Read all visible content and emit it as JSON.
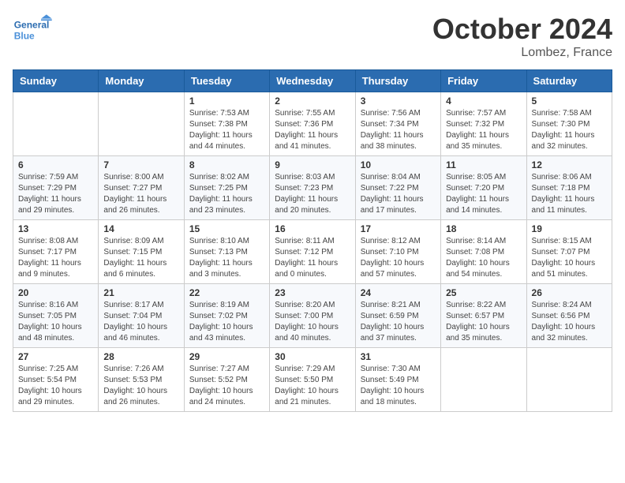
{
  "header": {
    "logo_general": "General",
    "logo_blue": "Blue",
    "month": "October 2024",
    "location": "Lombez, France"
  },
  "weekdays": [
    "Sunday",
    "Monday",
    "Tuesday",
    "Wednesday",
    "Thursday",
    "Friday",
    "Saturday"
  ],
  "weeks": [
    [
      {
        "day": "",
        "sunrise": "",
        "sunset": "",
        "daylight": ""
      },
      {
        "day": "",
        "sunrise": "",
        "sunset": "",
        "daylight": ""
      },
      {
        "day": "1",
        "sunrise": "Sunrise: 7:53 AM",
        "sunset": "Sunset: 7:38 PM",
        "daylight": "Daylight: 11 hours and 44 minutes."
      },
      {
        "day": "2",
        "sunrise": "Sunrise: 7:55 AM",
        "sunset": "Sunset: 7:36 PM",
        "daylight": "Daylight: 11 hours and 41 minutes."
      },
      {
        "day": "3",
        "sunrise": "Sunrise: 7:56 AM",
        "sunset": "Sunset: 7:34 PM",
        "daylight": "Daylight: 11 hours and 38 minutes."
      },
      {
        "day": "4",
        "sunrise": "Sunrise: 7:57 AM",
        "sunset": "Sunset: 7:32 PM",
        "daylight": "Daylight: 11 hours and 35 minutes."
      },
      {
        "day": "5",
        "sunrise": "Sunrise: 7:58 AM",
        "sunset": "Sunset: 7:30 PM",
        "daylight": "Daylight: 11 hours and 32 minutes."
      }
    ],
    [
      {
        "day": "6",
        "sunrise": "Sunrise: 7:59 AM",
        "sunset": "Sunset: 7:29 PM",
        "daylight": "Daylight: 11 hours and 29 minutes."
      },
      {
        "day": "7",
        "sunrise": "Sunrise: 8:00 AM",
        "sunset": "Sunset: 7:27 PM",
        "daylight": "Daylight: 11 hours and 26 minutes."
      },
      {
        "day": "8",
        "sunrise": "Sunrise: 8:02 AM",
        "sunset": "Sunset: 7:25 PM",
        "daylight": "Daylight: 11 hours and 23 minutes."
      },
      {
        "day": "9",
        "sunrise": "Sunrise: 8:03 AM",
        "sunset": "Sunset: 7:23 PM",
        "daylight": "Daylight: 11 hours and 20 minutes."
      },
      {
        "day": "10",
        "sunrise": "Sunrise: 8:04 AM",
        "sunset": "Sunset: 7:22 PM",
        "daylight": "Daylight: 11 hours and 17 minutes."
      },
      {
        "day": "11",
        "sunrise": "Sunrise: 8:05 AM",
        "sunset": "Sunset: 7:20 PM",
        "daylight": "Daylight: 11 hours and 14 minutes."
      },
      {
        "day": "12",
        "sunrise": "Sunrise: 8:06 AM",
        "sunset": "Sunset: 7:18 PM",
        "daylight": "Daylight: 11 hours and 11 minutes."
      }
    ],
    [
      {
        "day": "13",
        "sunrise": "Sunrise: 8:08 AM",
        "sunset": "Sunset: 7:17 PM",
        "daylight": "Daylight: 11 hours and 9 minutes."
      },
      {
        "day": "14",
        "sunrise": "Sunrise: 8:09 AM",
        "sunset": "Sunset: 7:15 PM",
        "daylight": "Daylight: 11 hours and 6 minutes."
      },
      {
        "day": "15",
        "sunrise": "Sunrise: 8:10 AM",
        "sunset": "Sunset: 7:13 PM",
        "daylight": "Daylight: 11 hours and 3 minutes."
      },
      {
        "day": "16",
        "sunrise": "Sunrise: 8:11 AM",
        "sunset": "Sunset: 7:12 PM",
        "daylight": "Daylight: 11 hours and 0 minutes."
      },
      {
        "day": "17",
        "sunrise": "Sunrise: 8:12 AM",
        "sunset": "Sunset: 7:10 PM",
        "daylight": "Daylight: 10 hours and 57 minutes."
      },
      {
        "day": "18",
        "sunrise": "Sunrise: 8:14 AM",
        "sunset": "Sunset: 7:08 PM",
        "daylight": "Daylight: 10 hours and 54 minutes."
      },
      {
        "day": "19",
        "sunrise": "Sunrise: 8:15 AM",
        "sunset": "Sunset: 7:07 PM",
        "daylight": "Daylight: 10 hours and 51 minutes."
      }
    ],
    [
      {
        "day": "20",
        "sunrise": "Sunrise: 8:16 AM",
        "sunset": "Sunset: 7:05 PM",
        "daylight": "Daylight: 10 hours and 48 minutes."
      },
      {
        "day": "21",
        "sunrise": "Sunrise: 8:17 AM",
        "sunset": "Sunset: 7:04 PM",
        "daylight": "Daylight: 10 hours and 46 minutes."
      },
      {
        "day": "22",
        "sunrise": "Sunrise: 8:19 AM",
        "sunset": "Sunset: 7:02 PM",
        "daylight": "Daylight: 10 hours and 43 minutes."
      },
      {
        "day": "23",
        "sunrise": "Sunrise: 8:20 AM",
        "sunset": "Sunset: 7:00 PM",
        "daylight": "Daylight: 10 hours and 40 minutes."
      },
      {
        "day": "24",
        "sunrise": "Sunrise: 8:21 AM",
        "sunset": "Sunset: 6:59 PM",
        "daylight": "Daylight: 10 hours and 37 minutes."
      },
      {
        "day": "25",
        "sunrise": "Sunrise: 8:22 AM",
        "sunset": "Sunset: 6:57 PM",
        "daylight": "Daylight: 10 hours and 35 minutes."
      },
      {
        "day": "26",
        "sunrise": "Sunrise: 8:24 AM",
        "sunset": "Sunset: 6:56 PM",
        "daylight": "Daylight: 10 hours and 32 minutes."
      }
    ],
    [
      {
        "day": "27",
        "sunrise": "Sunrise: 7:25 AM",
        "sunset": "Sunset: 5:54 PM",
        "daylight": "Daylight: 10 hours and 29 minutes."
      },
      {
        "day": "28",
        "sunrise": "Sunrise: 7:26 AM",
        "sunset": "Sunset: 5:53 PM",
        "daylight": "Daylight: 10 hours and 26 minutes."
      },
      {
        "day": "29",
        "sunrise": "Sunrise: 7:27 AM",
        "sunset": "Sunset: 5:52 PM",
        "daylight": "Daylight: 10 hours and 24 minutes."
      },
      {
        "day": "30",
        "sunrise": "Sunrise: 7:29 AM",
        "sunset": "Sunset: 5:50 PM",
        "daylight": "Daylight: 10 hours and 21 minutes."
      },
      {
        "day": "31",
        "sunrise": "Sunrise: 7:30 AM",
        "sunset": "Sunset: 5:49 PM",
        "daylight": "Daylight: 10 hours and 18 minutes."
      },
      {
        "day": "",
        "sunrise": "",
        "sunset": "",
        "daylight": ""
      },
      {
        "day": "",
        "sunrise": "",
        "sunset": "",
        "daylight": ""
      }
    ]
  ]
}
